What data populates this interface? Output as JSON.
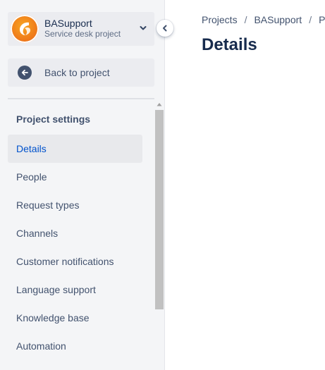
{
  "project": {
    "name": "BASupport",
    "type": "Service desk project"
  },
  "back": {
    "label": "Back to project"
  },
  "settings": {
    "title": "Project settings",
    "items": [
      {
        "label": "Details",
        "active": true
      },
      {
        "label": "People"
      },
      {
        "label": "Request types"
      },
      {
        "label": "Channels"
      },
      {
        "label": "Customer notifications"
      },
      {
        "label": "Language support"
      },
      {
        "label": "Knowledge base"
      },
      {
        "label": "Automation"
      }
    ]
  },
  "breadcrumb": [
    "Projects",
    "BASupport",
    "Pr"
  ],
  "page": {
    "title": "Details"
  },
  "colors": {
    "accent": "#0052cc",
    "sidebar_bg": "#f4f5f7",
    "avatar": "#f07d1a"
  },
  "icons": {
    "avatar": "project-avatar-icon",
    "switcher": "chevron-down-icon",
    "collapse": "chevron-left-icon",
    "back": "arrow-left-icon",
    "scroll": "scroll-up-arrow-icon"
  }
}
